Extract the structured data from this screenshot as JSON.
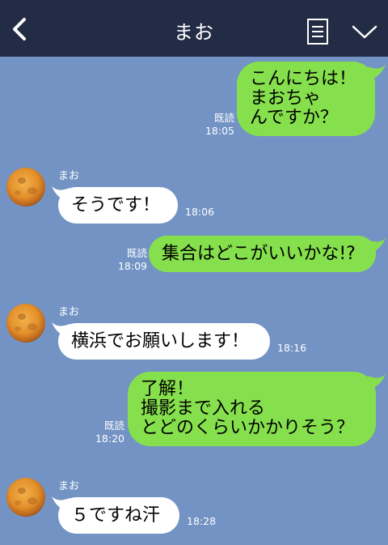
{
  "header": {
    "title": "まお",
    "back_icon": "chevron-left-icon",
    "menu_icon": "list-icon",
    "expand_icon": "chevron-down-icon",
    "background": "#232c45"
  },
  "colors": {
    "chat_background": "#7293c4",
    "outgoing_bubble": "#86e04d",
    "incoming_bubble": "#ffffff",
    "meta_text": "#ffffff"
  },
  "messages": [
    {
      "direction": "outgoing",
      "lines": [
        "こんにちは！",
        "まおちゃ",
        "んですか？"
      ],
      "read_label": "既読",
      "time": "18:05"
    },
    {
      "direction": "incoming",
      "sender": "まお",
      "lines": [
        "そうです！"
      ],
      "time": "18:06"
    },
    {
      "direction": "outgoing",
      "lines": [
        "集合はどこがいいかな!?"
      ],
      "read_label": "既読",
      "time": "18:09"
    },
    {
      "direction": "incoming",
      "sender": "まお",
      "lines": [
        "横浜でお願いします！"
      ],
      "time": "18:16"
    },
    {
      "direction": "outgoing",
      "lines": [
        "了解！",
        "撮影まで入れる",
        "とどのくらいかかりそう？"
      ],
      "read_label": "既読",
      "time": "18:20"
    },
    {
      "direction": "incoming",
      "sender": "まお",
      "lines": [
        "５ですね汗"
      ],
      "time": "18:28"
    }
  ]
}
